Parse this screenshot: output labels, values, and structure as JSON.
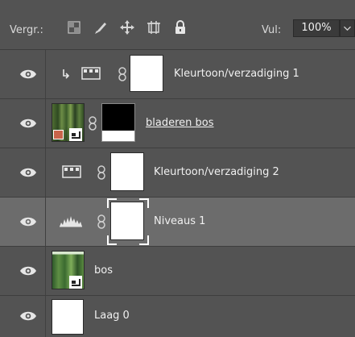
{
  "toolbar": {
    "lock_label": "Vergr.:",
    "icons": [
      "lock-transparent-pixels-icon",
      "lock-image-pixels-icon",
      "lock-position-icon",
      "lock-artboard-icon",
      "lock-all-icon"
    ],
    "fill_label": "Vul:",
    "fill_value": "100%",
    "fill_dropdown_icon": "chevron-down-icon"
  },
  "layers": [
    {
      "name": "Kleurtoon/verzadiging 1",
      "type": "adjustment-hue-saturation",
      "clipped": true,
      "visible": true,
      "selected": false,
      "underlined": false
    },
    {
      "name": "bladeren bos",
      "type": "image-with-mask",
      "visible": true,
      "selected": false,
      "underlined": true
    },
    {
      "name": "Kleurtoon/verzadiging 2",
      "type": "adjustment-hue-saturation",
      "visible": true,
      "selected": false,
      "underlined": false
    },
    {
      "name": "Niveaus 1",
      "type": "adjustment-levels",
      "visible": true,
      "selected": true,
      "underlined": false
    },
    {
      "name": "bos",
      "type": "smart-object",
      "visible": true,
      "selected": false,
      "underlined": false
    },
    {
      "name": "Laag 0",
      "type": "pixel",
      "visible": true,
      "selected": false,
      "underlined": false
    }
  ],
  "colors": {
    "panel_bg": "#535353",
    "selected_row_bg": "#6c6c6c",
    "text": "#f0f0f0"
  }
}
